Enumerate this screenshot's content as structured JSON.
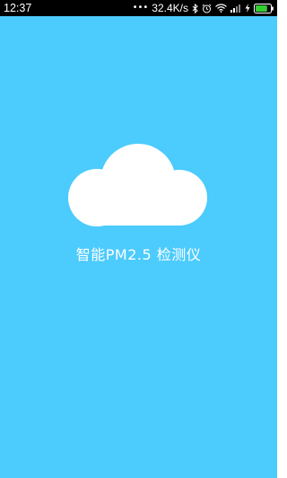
{
  "status_bar": {
    "time": "12:37",
    "network_dots": "•••",
    "network_speed": "32.4K/s",
    "icons": [
      "bluetooth-icon",
      "alarm-icon",
      "wifi-icon",
      "signal-icon",
      "charging-icon",
      "battery-icon"
    ],
    "battery_level": 0.8
  },
  "splash": {
    "logo_icon": "cloud-icon",
    "title": "智能PM2.5 检测仪"
  },
  "colors": {
    "background": "#4ccbfd",
    "status_bar": "#000000",
    "cloud": "#ffffff",
    "battery_fill": "#33cc33"
  }
}
